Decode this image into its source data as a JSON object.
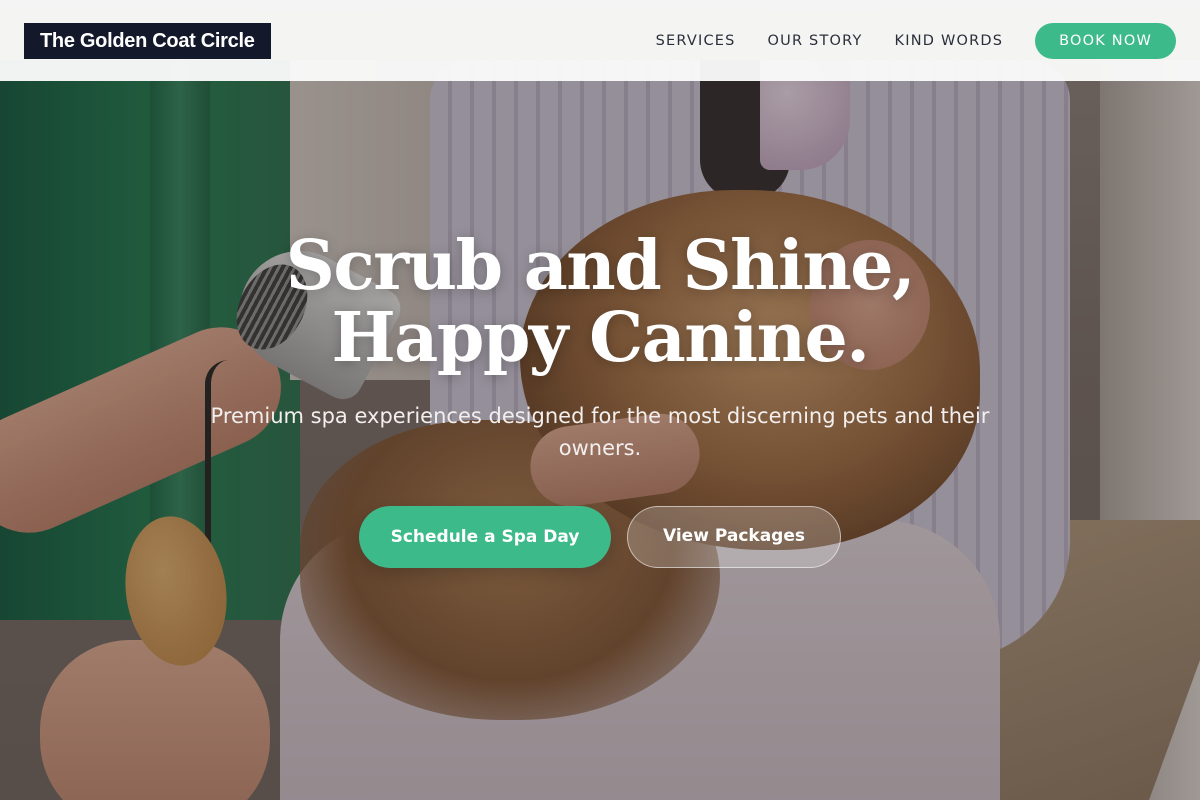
{
  "brand": {
    "name": "The Golden Coat Circle"
  },
  "nav": {
    "items": [
      {
        "label": "SERVICES"
      },
      {
        "label": "OUR STORY"
      },
      {
        "label": "KIND WORDS"
      }
    ],
    "book_label": "BOOK NOW"
  },
  "hero": {
    "title_line1": "Scrub and Shine,",
    "title_line2": "Happy Canine.",
    "subtitle": "Premium spa experiences designed for the most discerning pets and their owners.",
    "primary_cta": "Schedule a Spa Day",
    "secondary_cta": "View Packages"
  },
  "colors": {
    "accent": "#3dba8a",
    "logo_bg": "#13182b",
    "header_bg": "#fafafa"
  },
  "background_image": {
    "icon": "groomer-drying-dog-photo"
  }
}
